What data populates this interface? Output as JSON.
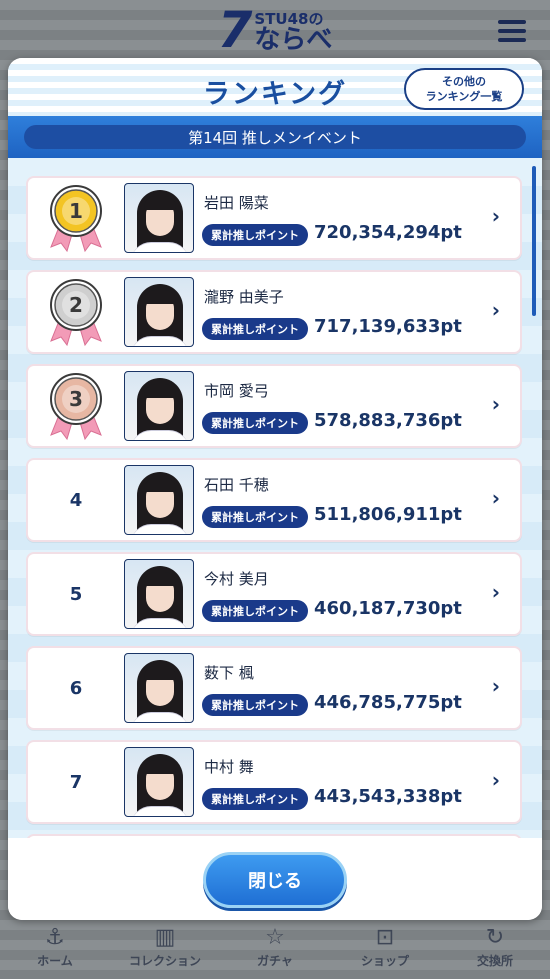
{
  "app": {
    "logo_number": "7",
    "logo_top": "STU48の",
    "logo_bottom": "ならべ"
  },
  "bottom_nav": [
    {
      "label": "ホーム",
      "icon": "anchor-icon"
    },
    {
      "label": "コレクション",
      "icon": "collection-icon"
    },
    {
      "label": "ガチャ",
      "icon": "gacha-icon"
    },
    {
      "label": "ショップ",
      "icon": "cart-icon"
    },
    {
      "label": "交換所",
      "icon": "exchange-icon"
    }
  ],
  "modal": {
    "title": "ランキング",
    "other_button_line1": "その他の",
    "other_button_line2": "ランキング一覧",
    "event_title": "第14回 推しメンイベント",
    "points_label": "累計推しポイント",
    "close_label": "閉じる"
  },
  "rankings": [
    {
      "rank": "1",
      "name": "岩田 陽菜",
      "points": "720,354,294pt",
      "medal": "gold"
    },
    {
      "rank": "2",
      "name": "瀧野 由美子",
      "points": "717,139,633pt",
      "medal": "silver"
    },
    {
      "rank": "3",
      "name": "市岡 愛弓",
      "points": "578,883,736pt",
      "medal": "bronze"
    },
    {
      "rank": "4",
      "name": "石田 千穂",
      "points": "511,806,911pt",
      "medal": ""
    },
    {
      "rank": "5",
      "name": "今村 美月",
      "points": "460,187,730pt",
      "medal": ""
    },
    {
      "rank": "6",
      "name": "薮下 楓",
      "points": "446,785,775pt",
      "medal": ""
    },
    {
      "rank": "7",
      "name": "中村 舞",
      "points": "443,543,338pt",
      "medal": ""
    }
  ],
  "colors": {
    "gold": "#f3c423",
    "silver": "#cfcfcf",
    "bronze": "#e7b7a3",
    "ribbon": "#f29bb7",
    "navy": "#1a3566"
  }
}
